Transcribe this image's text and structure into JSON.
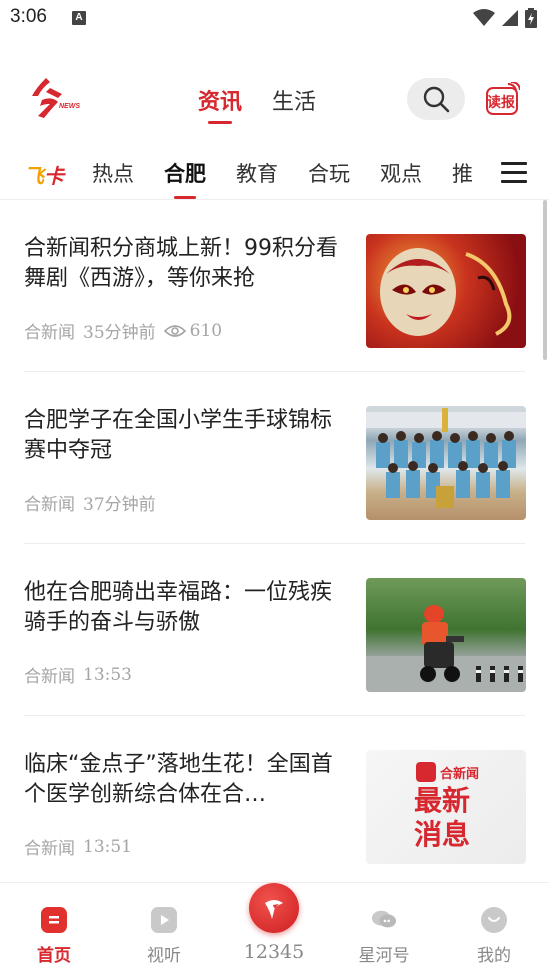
{
  "status_bar": {
    "time": "3:06",
    "notif_icon": "A"
  },
  "header": {
    "logo_icon": "hefei-news-logo",
    "tabs": [
      {
        "label": "资讯",
        "active": true
      },
      {
        "label": "生活",
        "active": false
      }
    ],
    "search_icon": "search-icon",
    "read_label": "读报"
  },
  "categories": {
    "feika_a": "飞",
    "feika_b": "卡",
    "items": [
      {
        "label": "热点",
        "active": false
      },
      {
        "label": "合肥",
        "active": true
      },
      {
        "label": "教育",
        "active": false
      },
      {
        "label": "合玩",
        "active": false
      },
      {
        "label": "观点",
        "active": false
      },
      {
        "label": "推",
        "active": false
      }
    ]
  },
  "feed": [
    {
      "title": "合新闻积分商城上新！99积分看舞剧《西游》，等你来抢",
      "source": "合新闻",
      "time": "35分钟前",
      "views": "610"
    },
    {
      "title": "合肥学子在全国小学生手球锦标赛中夺冠",
      "source": "合新闻",
      "time": "37分钟前",
      "views": ""
    },
    {
      "title": "他在合肥骑出幸福路：一位残疾骑手的奋斗与骄傲",
      "source": "合新闻",
      "time": "13:53",
      "views": ""
    },
    {
      "title": "临床“金点子”落地生花！全国首个医学创新综合体在合…",
      "source": "合新闻",
      "time": "13:51",
      "views": ""
    }
  ],
  "thumb4": {
    "brand": "合新闻",
    "line1": "最新",
    "line2": "消息"
  },
  "bottom_nav": [
    {
      "label": "首页",
      "active": true
    },
    {
      "label": "视听",
      "active": false
    },
    {
      "label": "12345",
      "active": false
    },
    {
      "label": "星河号",
      "active": false
    },
    {
      "label": "我的",
      "active": false
    }
  ],
  "colors": {
    "accent": "#d7282f",
    "feika_yellow": "#f2a100"
  }
}
